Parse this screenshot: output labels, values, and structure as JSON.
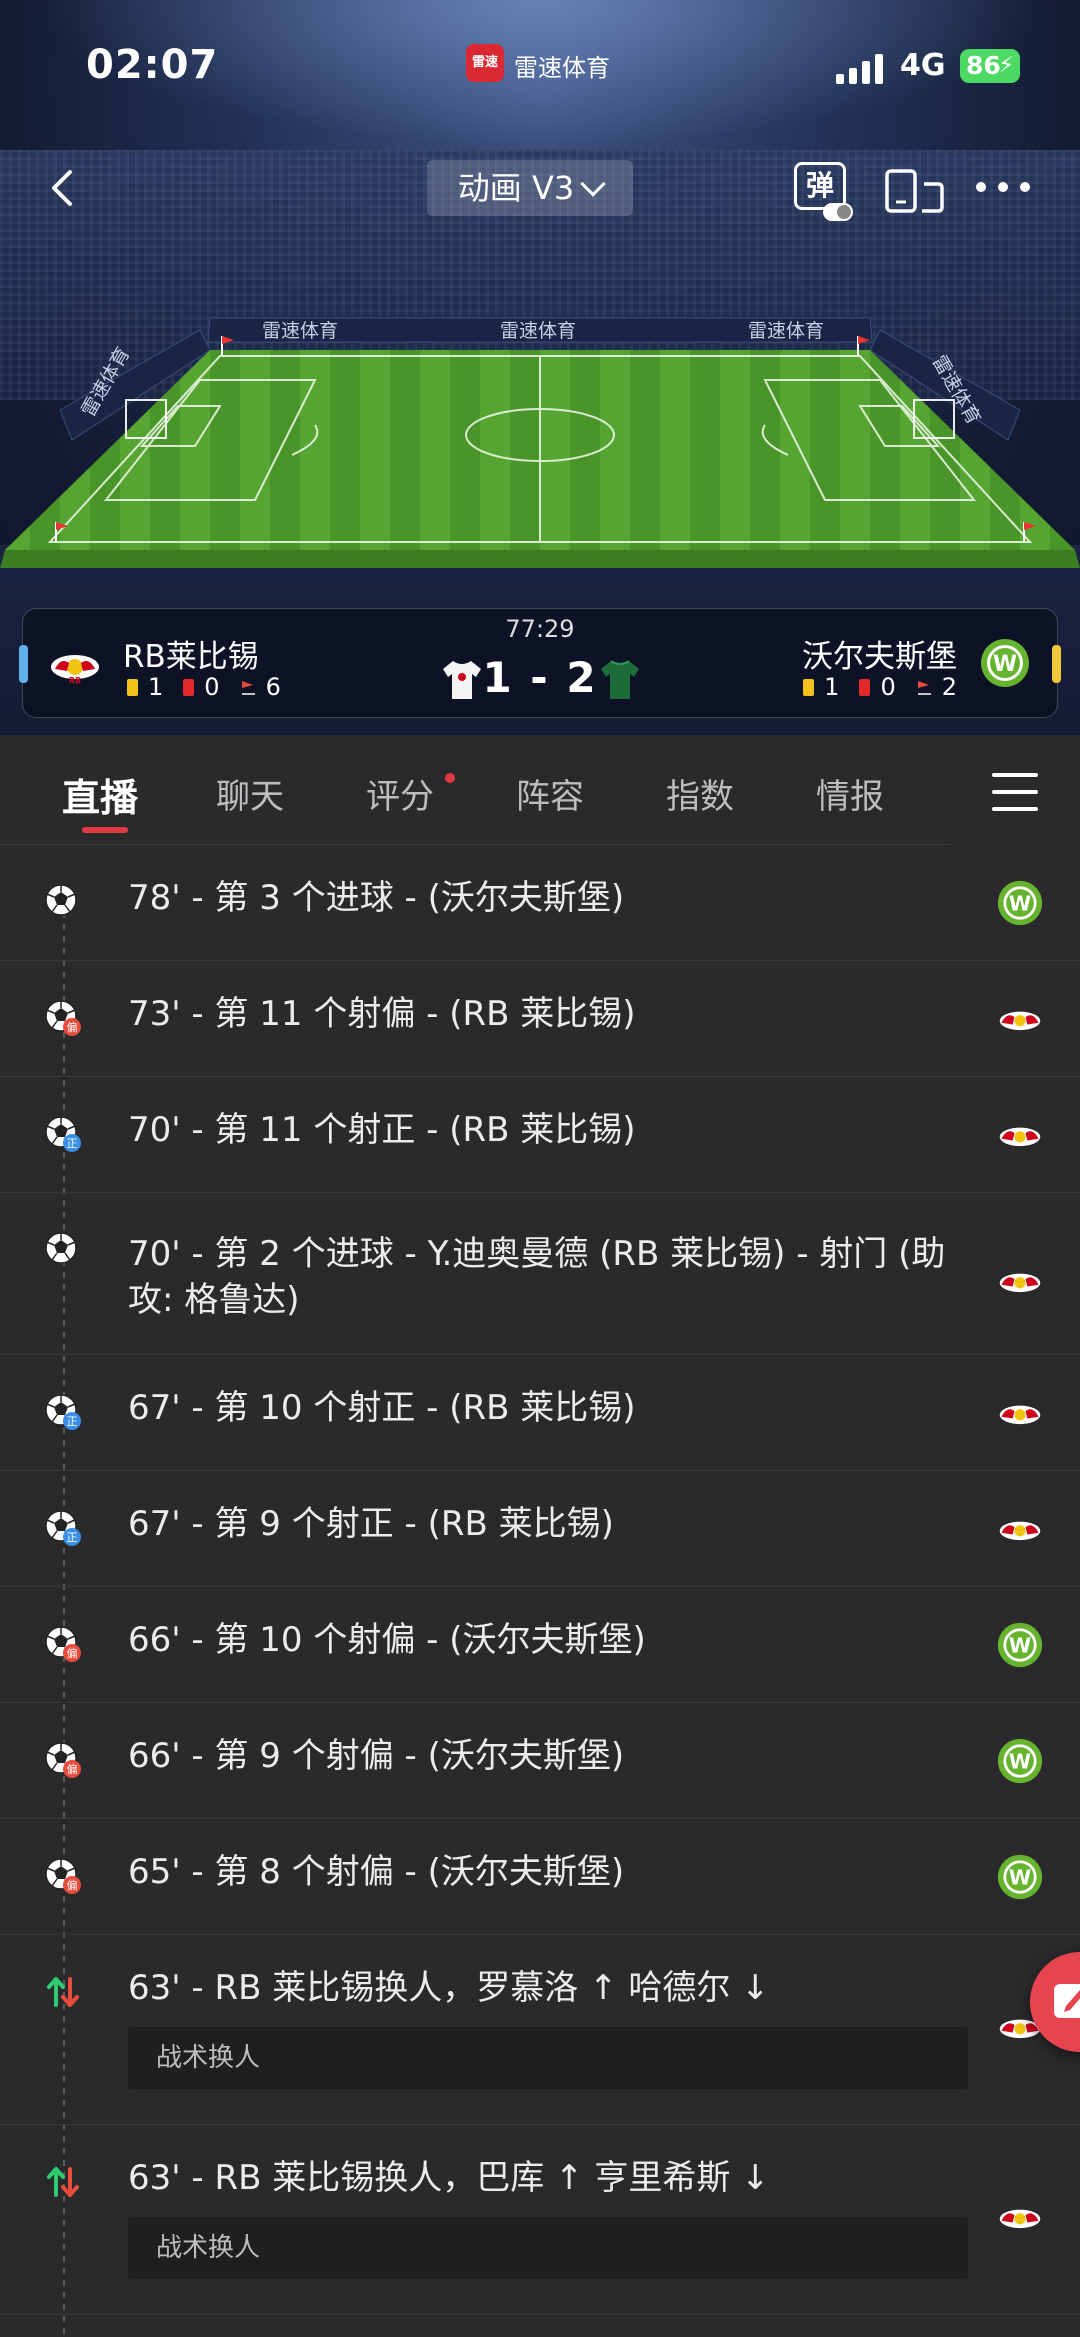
{
  "status_bar": {
    "time": "02:07",
    "app_badge": "雷速",
    "app_name": "雷速体育",
    "network": "4G",
    "battery": "86"
  },
  "top_bar": {
    "animation_mode": "动画 V3",
    "danmu_label": "弹"
  },
  "field_ads": [
    "雷速体育",
    "雷速体育",
    "雷速体育",
    "雷速体育",
    "雷速体育"
  ],
  "match": {
    "time": "77:29",
    "score": "1 - 2",
    "home": {
      "name": "RB莱比锡",
      "yellow": "1",
      "red": "0",
      "corners": "6",
      "color": "#5fb3ea"
    },
    "away": {
      "name": "沃尔夫斯堡",
      "yellow": "1",
      "red": "0",
      "corners": "2",
      "color": "#f0c93a"
    }
  },
  "tabs": [
    {
      "label": "直播",
      "active": true
    },
    {
      "label": "聊天",
      "active": false
    },
    {
      "label": "评分",
      "active": false,
      "dot": true
    },
    {
      "label": "阵容",
      "active": false
    },
    {
      "label": "指数",
      "active": false
    },
    {
      "label": "情报",
      "active": false
    }
  ],
  "events": [
    {
      "text": "78' - 第 3 个进球 - (沃尔夫斯堡)",
      "icon": "goal-icon",
      "team": "away"
    },
    {
      "text": "73' - 第 11 个射偏 - (RB 莱比锡)",
      "icon": "shot-off-target-icon",
      "team": "home"
    },
    {
      "text": "70' - 第 11 个射正 - (RB 莱比锡)",
      "icon": "shot-on-target-icon",
      "team": "home"
    },
    {
      "text": "70' - 第 2 个进球 - Y.迪奥曼德 (RB 莱比锡) - 射门 (助攻: 格鲁达)",
      "icon": "goal-icon",
      "team": "home"
    },
    {
      "text": "67' - 第 10 个射正 - (RB 莱比锡)",
      "icon": "shot-on-target-icon",
      "team": "home"
    },
    {
      "text": "67' - 第 9 个射正 - (RB 莱比锡)",
      "icon": "shot-on-target-icon",
      "team": "home"
    },
    {
      "text": "66' - 第 10 个射偏 - (沃尔夫斯堡)",
      "icon": "shot-off-target-icon",
      "team": "away"
    },
    {
      "text": "66' - 第 9 个射偏 - (沃尔夫斯堡)",
      "icon": "shot-off-target-icon",
      "team": "away"
    },
    {
      "text": "65' - 第 8 个射偏 - (沃尔夫斯堡)",
      "icon": "shot-off-target-icon",
      "team": "away"
    },
    {
      "text": "63' - RB 莱比锡换人，罗慕洛 ↑ 哈德尔 ↓",
      "icon": "substitution-icon",
      "team": "home",
      "sub": "战术换人"
    },
    {
      "text": "63' - RB 莱比锡换人，巴库 ↑ 亨里希斯 ↓",
      "icon": "substitution-icon",
      "team": "home",
      "sub": "战术换人"
    }
  ],
  "icon_badges": {
    "on_target": "正",
    "off_target": "偏"
  },
  "colors": {
    "accent_red": "#e23a44",
    "pitch_green": "#4f9a2e",
    "background": "#2a2a2d"
  }
}
